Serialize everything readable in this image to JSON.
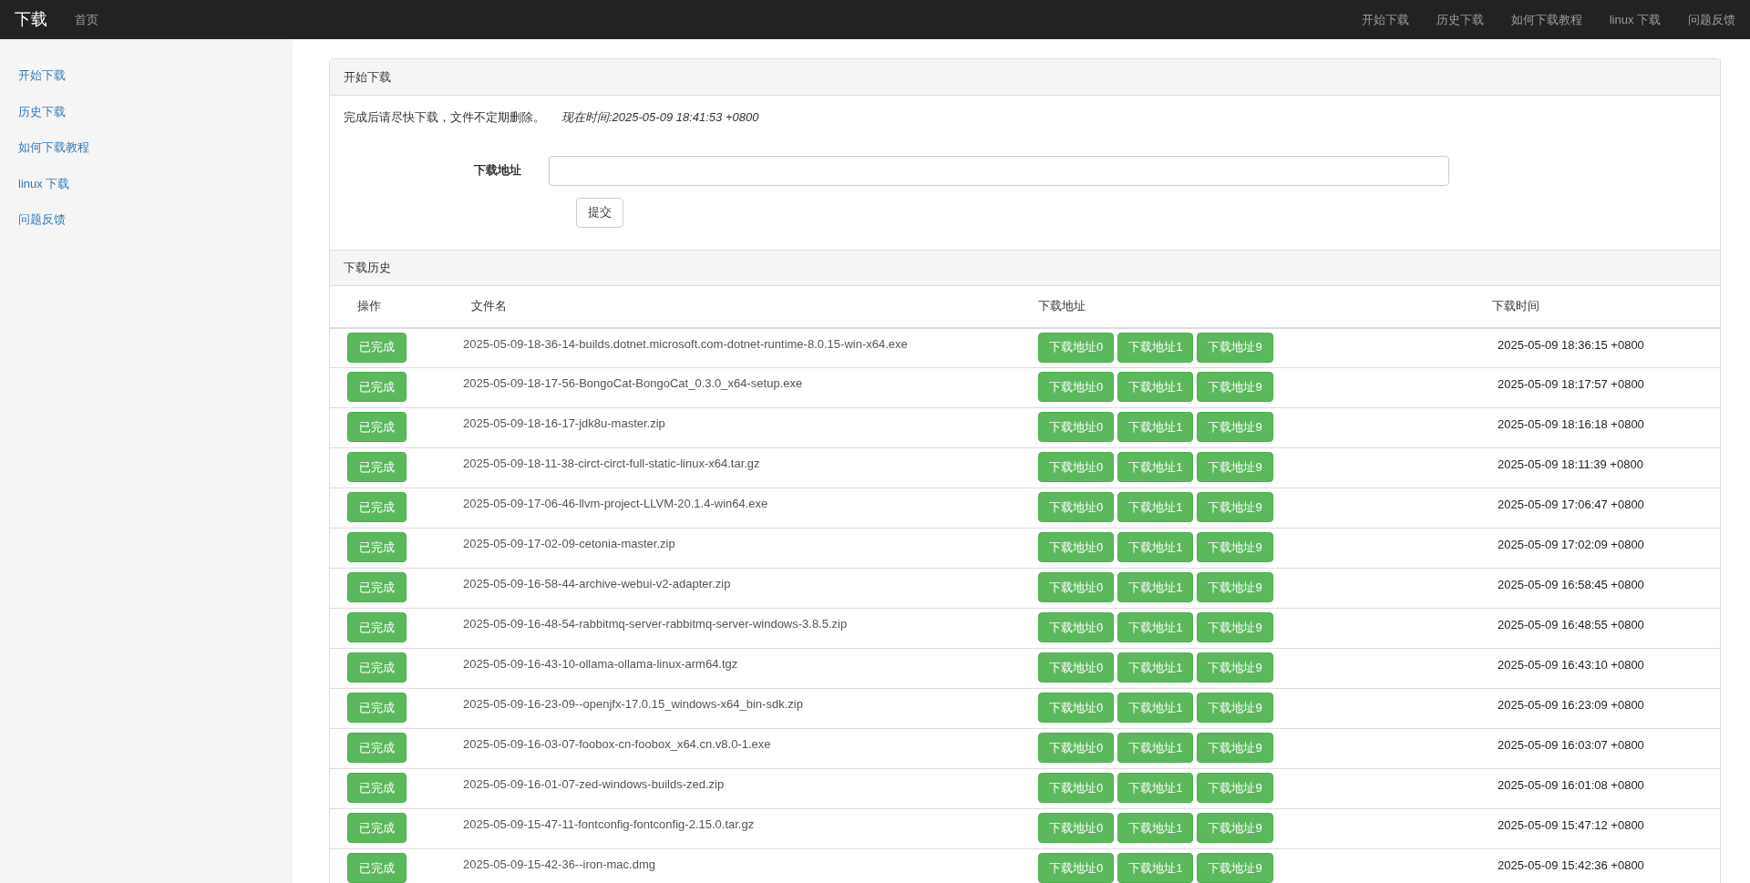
{
  "navbar": {
    "brand": "下载",
    "home": "首页",
    "links": [
      "开始下载",
      "历史下载",
      "如何下载教程",
      "linux 下载",
      "问题反馈"
    ]
  },
  "sidebar": {
    "items": [
      "开始下载",
      "历史下载",
      "如何下载教程",
      "linux 下载",
      "问题反馈"
    ]
  },
  "start_panel": {
    "title": "开始下载",
    "notice": "完成后请尽快下载，文件不定期删除。",
    "current_time": "现在时间:2025-05-09 18:41:53 +0800",
    "field_label": "下载地址",
    "submit": "提交"
  },
  "history_panel": {
    "title": "下载历史",
    "columns": [
      "操作",
      "文件名",
      "下载地址",
      "下载时间"
    ],
    "rows": [
      {
        "status": "已完成",
        "filename": "2025-05-09-18-36-14-builds.dotnet.microsoft.com-dotnet-runtime-8.0.15-win-x64.exe",
        "links": [
          "下载地址0",
          "下载地址1",
          "下载地址9"
        ],
        "time": "2025-05-09 18:36:15 +0800"
      },
      {
        "status": "已完成",
        "filename": "2025-05-09-18-17-56-BongoCat-BongoCat_0.3.0_x64-setup.exe",
        "links": [
          "下载地址0",
          "下载地址1",
          "下载地址9"
        ],
        "time": "2025-05-09 18:17:57 +0800"
      },
      {
        "status": "已完成",
        "filename": "2025-05-09-18-16-17-jdk8u-master.zip",
        "links": [
          "下载地址0",
          "下载地址1",
          "下载地址9"
        ],
        "time": "2025-05-09 18:16:18 +0800"
      },
      {
        "status": "已完成",
        "filename": "2025-05-09-18-11-38-circt-circt-full-static-linux-x64.tar.gz",
        "links": [
          "下载地址0",
          "下载地址1",
          "下载地址9"
        ],
        "time": "2025-05-09 18:11:39 +0800"
      },
      {
        "status": "已完成",
        "filename": "2025-05-09-17-06-46-llvm-project-LLVM-20.1.4-win64.exe",
        "links": [
          "下载地址0",
          "下载地址1",
          "下载地址9"
        ],
        "time": "2025-05-09 17:06:47 +0800"
      },
      {
        "status": "已完成",
        "filename": "2025-05-09-17-02-09-cetonia-master.zip",
        "links": [
          "下载地址0",
          "下载地址1",
          "下载地址9"
        ],
        "time": "2025-05-09 17:02:09 +0800"
      },
      {
        "status": "已完成",
        "filename": "2025-05-09-16-58-44-archive-webui-v2-adapter.zip",
        "links": [
          "下载地址0",
          "下载地址1",
          "下载地址9"
        ],
        "time": "2025-05-09 16:58:45 +0800"
      },
      {
        "status": "已完成",
        "filename": "2025-05-09-16-48-54-rabbitmq-server-rabbitmq-server-windows-3.8.5.zip",
        "links": [
          "下载地址0",
          "下载地址1",
          "下载地址9"
        ],
        "time": "2025-05-09 16:48:55 +0800"
      },
      {
        "status": "已完成",
        "filename": "2025-05-09-16-43-10-ollama-ollama-linux-arm64.tgz",
        "links": [
          "下载地址0",
          "下载地址1",
          "下载地址9"
        ],
        "time": "2025-05-09 16:43:10 +0800"
      },
      {
        "status": "已完成",
        "filename": "2025-05-09-16-23-09--openjfx-17.0.15_windows-x64_bin-sdk.zip",
        "links": [
          "下载地址0",
          "下载地址1",
          "下载地址9"
        ],
        "time": "2025-05-09 16:23:09 +0800"
      },
      {
        "status": "已完成",
        "filename": "2025-05-09-16-03-07-foobox-cn-foobox_x64.cn.v8.0-1.exe",
        "links": [
          "下载地址0",
          "下载地址1",
          "下载地址9"
        ],
        "time": "2025-05-09 16:03:07 +0800"
      },
      {
        "status": "已完成",
        "filename": "2025-05-09-16-01-07-zed-windows-builds-zed.zip",
        "links": [
          "下载地址0",
          "下载地址1",
          "下载地址9"
        ],
        "time": "2025-05-09 16:01:08 +0800"
      },
      {
        "status": "已完成",
        "filename": "2025-05-09-15-47-11-fontconfig-fontconfig-2.15.0.tar.gz",
        "links": [
          "下载地址0",
          "下载地址1",
          "下载地址9"
        ],
        "time": "2025-05-09 15:47:12 +0800"
      },
      {
        "status": "已完成",
        "filename": "2025-05-09-15-42-36--iron-mac.dmg",
        "links": [
          "下载地址0",
          "下载地址1",
          "下载地址9"
        ],
        "time": "2025-05-09 15:42:36 +0800"
      }
    ]
  }
}
